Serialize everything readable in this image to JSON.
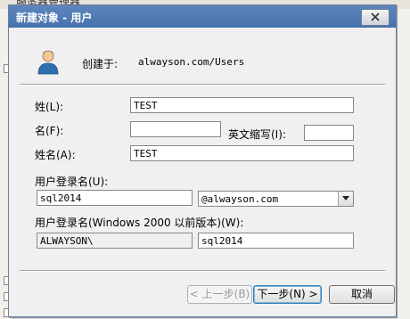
{
  "background": {
    "title": "服务器管理器"
  },
  "dialog": {
    "title": "新建对象 - 用户",
    "close_label": "×",
    "created_in_label": "创建于:",
    "created_in_value": "alwayson.com/Users"
  },
  "form": {
    "last_name_label": "姓(L):",
    "last_name_value": "TEST",
    "first_name_label": "名(F):",
    "first_name_value": "",
    "initials_label": "英文缩写(I):",
    "initials_value": "",
    "full_name_label": "姓名(A):",
    "full_name_value": "TEST",
    "logon_name_label": "用户登录名(U):",
    "logon_name_value": "sql2014",
    "domain_suffix_value": "@alwayson.com",
    "pre2000_label": "用户登录名(Windows 2000 以前版本)(W):",
    "pre2000_domain_value": "ALWAYSON\\",
    "pre2000_name_value": "sql2014"
  },
  "buttons": {
    "back_label": "< 上一步(B)",
    "next_label": "下一步(N) >",
    "cancel_label": "取消"
  },
  "colors": {
    "titlebar": "#4f7bb5",
    "dialog_bg": "#f0f0f0"
  },
  "icons": {
    "user": "user-icon",
    "close": "close-icon",
    "dropdown": "chevron-down-icon"
  }
}
